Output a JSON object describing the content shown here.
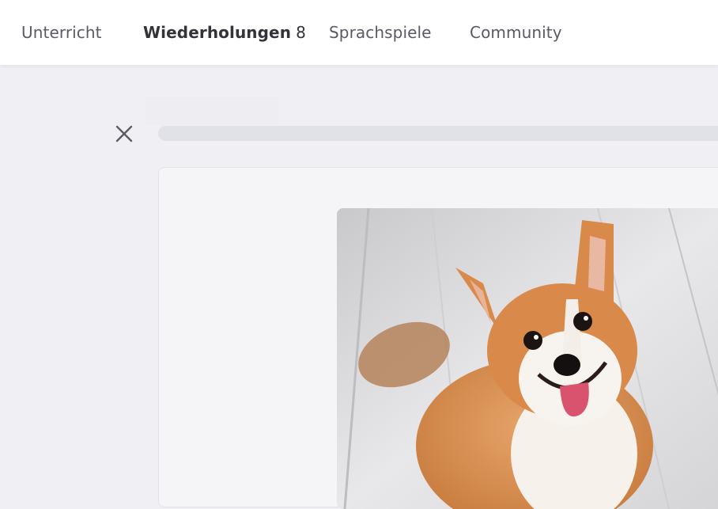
{
  "nav": {
    "items": [
      {
        "label": "Unterricht",
        "active": false
      },
      {
        "label": "Wiederholungen",
        "badge": "8",
        "active": true
      },
      {
        "label": "Sprachspiele",
        "active": false
      },
      {
        "label": "Community",
        "active": false
      }
    ]
  },
  "exercise": {
    "close_icon": "close-icon",
    "image_icon": "corgi-dog-photo"
  },
  "colors": {
    "page_background": "#f0f0f4",
    "nav_background": "#ffffff",
    "progress_track": "#e1e1e8",
    "card_background": "#f5f5f8"
  }
}
